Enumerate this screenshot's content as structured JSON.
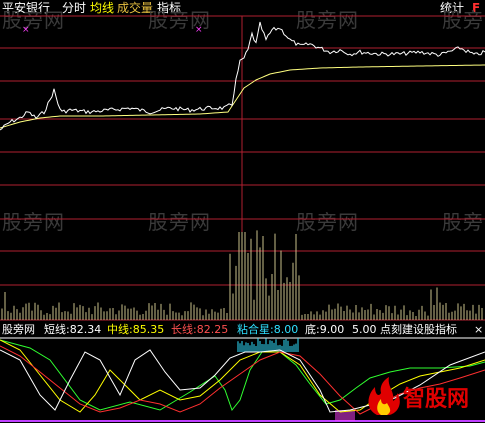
{
  "toolbar": {
    "stock_name": "平安银行",
    "tab_intraday": "分时",
    "tab_avg_line": "均线",
    "tab_volume": "成交量",
    "tab_indicator": "指标",
    "stats_label": "统计",
    "flag_mark": "F"
  },
  "watermark": "股旁网",
  "indicator_bar": {
    "source": "股旁网",
    "short_line": "短线:82.34",
    "mid_line": "中线:85.35",
    "long_line": "长线:82.25",
    "sticky": "粘合星:8.00",
    "bottom": "底:9.00",
    "extra": "5.00",
    "overlay": "点刻建设股指标",
    "close_glyph": "×"
  },
  "brand": {
    "name": "智股网"
  },
  "colors": {
    "price": "#ffffff",
    "avg": "#ffff80",
    "grid": "#c0303c",
    "volume": "#c8c08a",
    "short": "#ffffff",
    "mid": "#ffff00",
    "long": "#ff3030",
    "green": "#30ff30",
    "cyan_bar": "#30e0ff",
    "magenta_bar": "#ff40ff",
    "brand_red": "#e00000"
  }
}
